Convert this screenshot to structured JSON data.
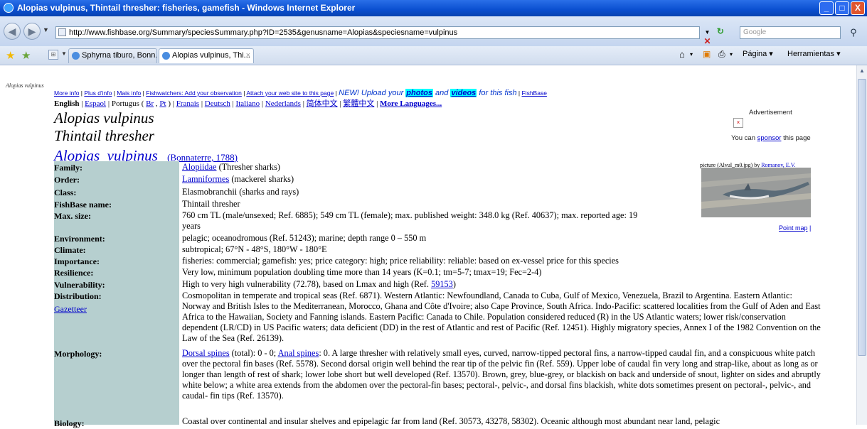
{
  "window": {
    "title": "Alopias vulpinus, Thintail thresher: fisheries, gamefish - Windows Internet Explorer",
    "minimize": "_",
    "maximize": "□",
    "close": "X"
  },
  "address": {
    "url": "http://www.fishbase.org/Summary/speciesSummary.php?ID=2535&genusname=Alopias&speciesname=vulpinus",
    "search_placeholder": "Google"
  },
  "tabs": [
    {
      "label": "Sphyrna tiburo, Bonn..."
    },
    {
      "label": "Alopias vulpinus, Thi..."
    }
  ],
  "command_bar": {
    "page": "Página ▾",
    "tools": "Herramientas ▾"
  },
  "page": {
    "breadcrumb": "Alopias vulpinus",
    "links": [
      "More info",
      "Plus d'info",
      "Mais info",
      "Fishwatchers: Add your observation",
      "Attach your web site to this page"
    ],
    "promo_prefix": "NEW! Upload your",
    "promo_photos": "photos",
    "promo_and": "and",
    "promo_videos": "videos",
    "promo_suffix": "for this fish",
    "fishbase_link": "FishBase",
    "lang_english": "English",
    "lang_espanol": "Espaol",
    "lang_portugues": "Portugus",
    "lang_br": "Br",
    "lang_pt": "Pt",
    "lang_francais": "Franais",
    "lang_deutsch": "Deutsch",
    "lang_italiano": "Italiano",
    "lang_nederlands": "Nederlands",
    "lang_cjk1": "简体中文",
    "lang_cjk2": "繁體中文",
    "lang_more": "More Languages...",
    "species_title": "Alopias vulpinus",
    "common_title": "Thintail thresher",
    "genus": "Alopias",
    "species": "vulpinus",
    "authority": "(Bonnaterre, 1788)",
    "advertisement": "Advertisement",
    "sponsor_prefix": "You can",
    "sponsor_link": "sponsor",
    "sponsor_suffix": "this page",
    "picture_caption": "picture (Alvul_m0.jpg) by",
    "picture_author": "Romanov, E.V.",
    "point_map": "Point map",
    "gazetteer": "Gazetteer",
    "rows": {
      "family_label": "Family:",
      "family_link": "Alopiidae",
      "family_rest": " (Thresher sharks)",
      "order_label": "Order:",
      "order_link": "Lamniformes",
      "order_rest": "  (mackerel sharks)",
      "class_label": "Class:",
      "class_val": "Elasmobranchii (sharks and rays)",
      "fbname_label": "FishBase name:",
      "fbname_val": "Thintail thresher",
      "maxsize_label": "Max. size:",
      "maxsize_val": "760 cm TL (male/unsexed; Ref. 6885); 549 cm TL (female); max. published weight: 348.0 kg (Ref. 40637); max. reported age: 19 years",
      "env_label": "Environment:",
      "env_val": "pelagic; oceanodromous (Ref. 51243); marine; depth range 0 – 550 m",
      "climate_label": "Climate:",
      "climate_val": "subtropical; 67°N - 48°S, 180°W - 180°E",
      "importance_label": "Importance:",
      "importance_val": "fisheries: commercial; gamefish: yes; price category: high; price reliability: reliable: based on ex-vessel price for this species",
      "resilience_label": "Resilience:",
      "resilience_val": "Very low, minimum population doubling time more than 14 years (K=0.1; tm=5-7; tmax=19; Fec=2-4)",
      "vuln_label": "Vulnerability:",
      "vuln_prefix": "High to very high vulnerability (72.78), based on Lmax and high (Ref.",
      "vuln_ref": "59153",
      "vuln_suffix": ")",
      "dist_label": "Distribution:",
      "dist_val": "Cosmopolitan in temperate and tropical seas (Ref. 6871). Western Atlantic: Newfoundland, Canada to Cuba, Gulf of Mexico, Venezuela, Brazil to Argentina. Eastern Atlantic: Norway and British Isles to the Mediterranean, Morocco, Ghana and Côte d'Ivoire; also Cape Province, South Africa. Indo-Pacific: scattered localities from the Gulf of Aden and East Africa to the Hawaiian, Society and Fanning islands. Eastern Pacific: Canada to Chile. Population considered reduced (R) in the US Atlantic waters; lower risk/conservation dependent (LR/CD) in US Pacific waters; data deficient (DD) in the rest of Atlantic and rest of Pacific (Ref. 12451). Highly migratory species, Annex I of the 1982 Convention on the Law of the Sea (Ref. 26139).",
      "morph_label": "Morphology:",
      "morph_dorsal": "Dorsal spines",
      "morph_mid": " (total): 0 - 0; ",
      "morph_anal": "Anal spines",
      "morph_val": ": 0. A large thresher with relatively small eyes, curved, narrow-tipped pectoral fins, a narrow-tipped caudal fin, and a conspicuous white patch over the pectoral fin bases (Ref. 5578). Second dorsal origin well behind the rear tip of the pelvic fin (Ref. 559). Upper lobe of caudal fin very long and strap-like, about as long as or longer than length of rest of shark; lower lobe short but well developed (Ref. 13570). Brown, grey, blue-grey, or blackish on back and underside of snout, lighter on sides and abruptly white below; a white area extends from the abdomen over the pectoral-fin bases; pectoral-, pelvic-, and dorsal fins blackish, white dots sometimes present on pectoral-, pelvic-, and caudal- fin tips (Ref. 13570).",
      "bio_label": "Biology:",
      "bio_val": "Coastal over continental and insular shelves and epipelagic far from land (Ref. 30573, 43278, 58302). Oceanic although most abundant near land, pelagic"
    }
  }
}
